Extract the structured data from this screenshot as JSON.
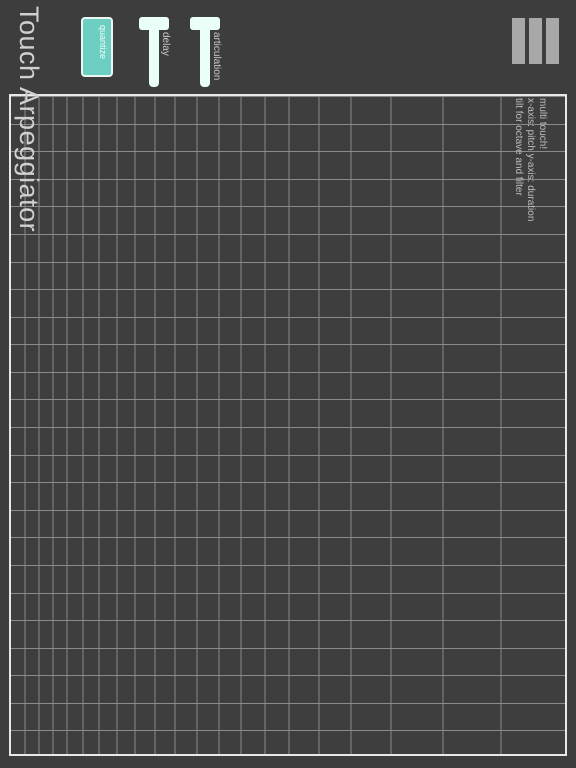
{
  "app": {
    "title": "Touch Arpeggiator"
  },
  "controls": {
    "quantize": {
      "label": "quantize",
      "active": true,
      "color": "#6dcfc2"
    },
    "delay": {
      "label": "delay"
    },
    "articulation": {
      "label": "articulation"
    }
  },
  "menu": {
    "icon": "menu-bars-icon"
  },
  "instructions": {
    "line1": "multi touch!",
    "line2": "x-axis: pitch  y-axis: duration",
    "line3": "tilt for octave and filter"
  },
  "colors": {
    "background": "#3d3d3d",
    "grid_line": "#8a8a8a",
    "accent": "#6dcfc2",
    "slider": "#eafff8"
  }
}
